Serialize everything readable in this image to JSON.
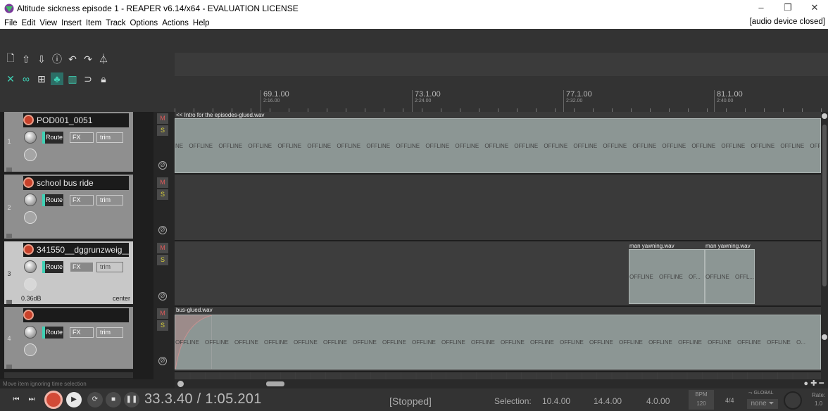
{
  "window": {
    "title": "Altitude sickness episode 1 - REAPER v6.14/x64 - EVALUATION LICENSE",
    "minimize": "–",
    "restore": "❐",
    "close": "✕"
  },
  "menu": {
    "items": [
      "File",
      "Edit",
      "View",
      "Insert",
      "Item",
      "Track",
      "Options",
      "Actions",
      "Help"
    ],
    "audio_status": "[audio device closed]"
  },
  "toolbar": {
    "row1": [
      "new-project-icon",
      "save-project-icon",
      "load-icon",
      "info-icon",
      "undo-icon",
      "redo-icon",
      "metronome-icon"
    ],
    "row2": [
      "ripple-edit-icon",
      "snap-link-icon",
      "grid-icon",
      "auto-crossfade-icon",
      "grid-lines-icon",
      "loop-icon",
      "lock-icon"
    ]
  },
  "ruler": {
    "marks": [
      {
        "bar": "69.1.00",
        "time": "2:16.00"
      },
      {
        "bar": "73.1.00",
        "time": "2:24.00"
      },
      {
        "bar": "77.1.00",
        "time": "2:32.00"
      },
      {
        "bar": "81.1.00",
        "time": "2:40.00"
      }
    ]
  },
  "tracks": [
    {
      "num": "1",
      "name": "POD001_0051",
      "route": "Route",
      "fx": "FX",
      "trim": "trim",
      "mute": "M",
      "solo": "S",
      "phase": "Ø"
    },
    {
      "num": "2",
      "name": "school bus ride",
      "route": "Route",
      "fx": "FX",
      "trim": "trim",
      "mute": "M",
      "solo": "S",
      "phase": "Ø"
    },
    {
      "num": "3",
      "name": "341550__dggrunzweig__",
      "route": "Route",
      "fx": "FX",
      "trim": "trim",
      "mute": "M",
      "solo": "S",
      "phase": "Ø",
      "volume": "0.36dB",
      "pan": "center"
    },
    {
      "num": "4",
      "name": "",
      "route": "Route",
      "fx": "FX",
      "trim": "trim",
      "mute": "M",
      "solo": "S",
      "phase": "Ø"
    }
  ],
  "items": {
    "track1": {
      "label": "<< Intro for the episodes-glued.wav",
      "offline_text": "NE OFFLINE OFFLINE OFFLINE OFFLINE OFFLINE OFFLINE OFFLINE OFFLINE OFFLINE OFFLINE OFFLINE OFFLINE OFFLINE OFFLINE OFFLINE OFFLINE OFFLINE OFFLINE OFFLINE OFFLINE OFFLINE OFFLINE"
    },
    "track3a": {
      "label": "man yawning.wav",
      "offline_text": "OFFLINE OFFLINE OF..."
    },
    "track3b": {
      "label": "man yawning.wav",
      "offline_text": "OFFLINE OFFL..."
    },
    "track4": {
      "label": "bus-glued.wav",
      "offline_text": "OFFLINE OFFLINE OFFLINE OFFLINE OFFLINE OFFLINE OFFLINE OFFLINE OFFLINE OFFLINE OFFLINE OFFLINE OFFLINE OFFLINE OFFLINE OFFLINE OFFLINE OFFLINE OFFLINE OFFLINE OFFLINE O..."
    }
  },
  "status": {
    "hint": "Move item ignoring time selection"
  },
  "transport": {
    "position": "33.3.40 / 1:05.201",
    "state": "[Stopped]",
    "selection_label": "Selection:",
    "sel_start": "10.4.00",
    "sel_end": "14.4.00",
    "sel_length": "4.0.00",
    "bpm_label": "BPM",
    "bpm": "120",
    "time_sig": "4/4",
    "global_label": "GLOBAL",
    "global_value": "none",
    "rate_label": "Rate:",
    "rate": "1.0"
  }
}
